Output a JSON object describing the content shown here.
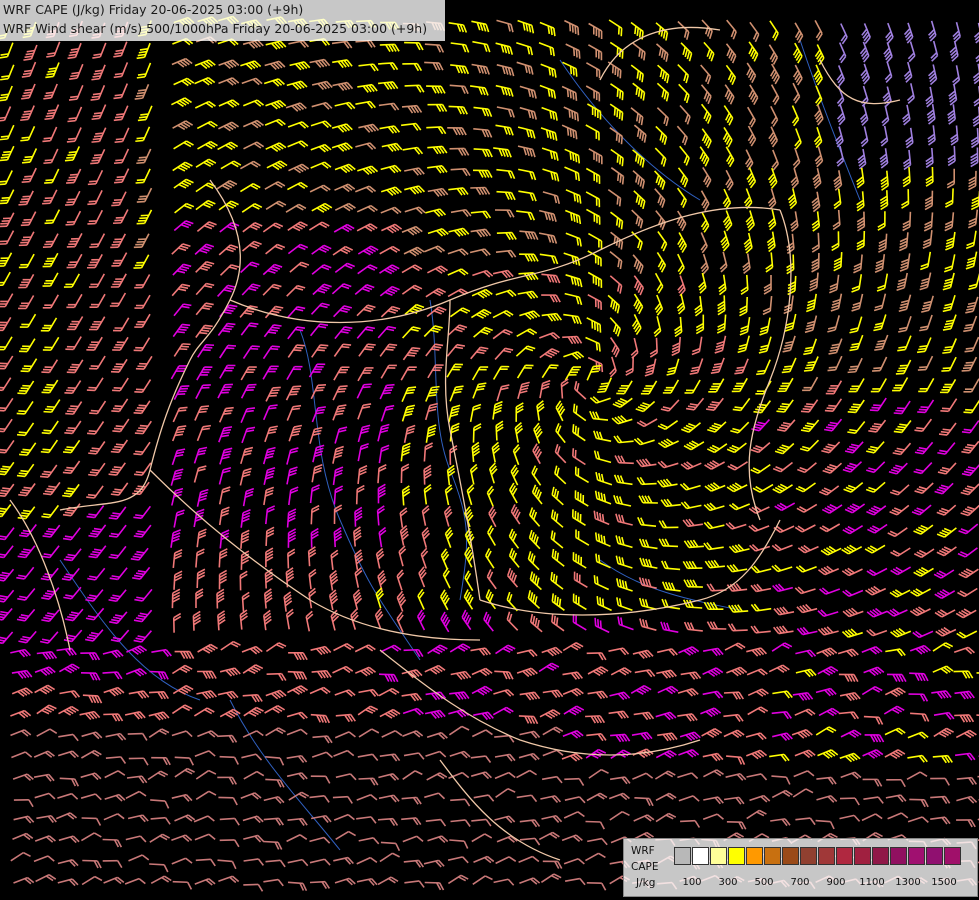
{
  "titles": {
    "line1": "WRF CAPE (J/kg) Friday 20-06-2025 03:00 (+9h)",
    "line2": "WRF Wind shear (m/s) 500/1000hPa Friday 20-06-2025 03:00 (+9h)"
  },
  "legend": {
    "label_model": "WRF",
    "label_field": "CAPE",
    "label_unit": "J/kg",
    "ticks": [
      "100",
      "300",
      "500",
      "700",
      "900",
      "1100",
      "1300",
      "1500"
    ],
    "colors": [
      "#b8b8b8",
      "#ffffff",
      "#ffff99",
      "#ffff00",
      "#ff9900",
      "#c87010",
      "#9a4a18",
      "#904030",
      "#a03838",
      "#b02840",
      "#a02040",
      "#901848",
      "#901060",
      "#a01070",
      "#901070",
      "#a0106a"
    ]
  },
  "barb_colors": {
    "yellow": "#ffff00",
    "salmon": "#f07878",
    "tan": "#d09070",
    "magenta": "#e000e0",
    "rosy": "#c87878",
    "grey": "#a0a0a0",
    "lilac": "#a080e0"
  },
  "map_colors": {
    "border": "#f0c8a8",
    "river": "#3060c0"
  }
}
